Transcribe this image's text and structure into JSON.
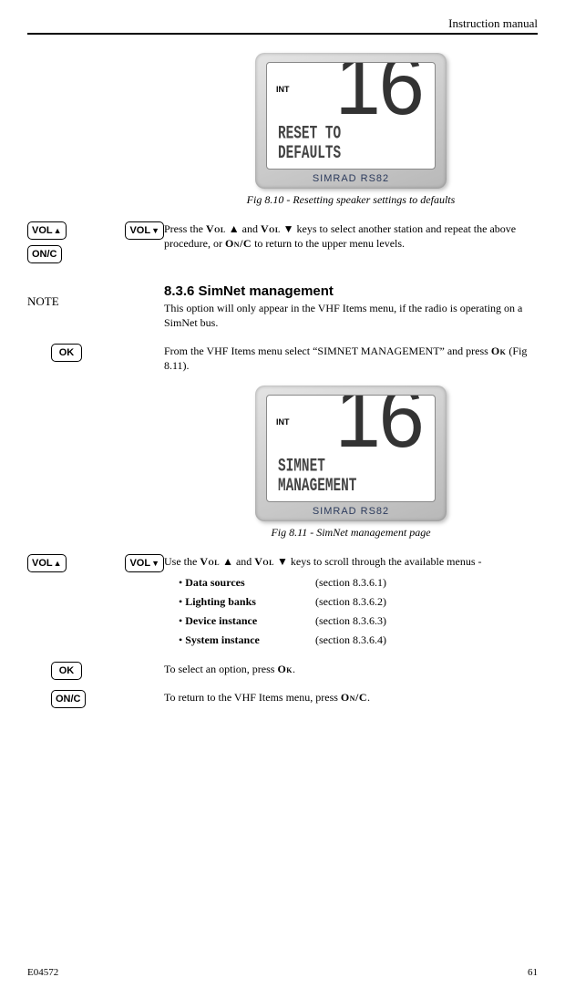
{
  "header": {
    "title": "Instruction manual"
  },
  "keys": {
    "vol_up": "VOL",
    "vol_down": "VOL",
    "on_c": "ON/C",
    "ok": "OK"
  },
  "device1": {
    "int": "INT",
    "channel": "16",
    "line1": "RESET TO",
    "line2": "DEFAULTS",
    "brand": "SIMRAD RS82"
  },
  "fig1_caption": "Fig 8.10 - Resetting speaker settings to defaults",
  "para1_a": "Press the ",
  "para1_vol1": "Vol",
  "para1_b": " ▲ and ",
  "para1_vol2": "Vol",
  "para1_c": " ▼ keys to select another station and repeat the above procedure, or ",
  "para1_onc": "On/C",
  "para1_d": " to return to the upper menu levels.",
  "section_title": "8.3.6  SimNet management",
  "note_label": "NOTE",
  "note_text": "This option will only appear in the VHF Items menu, if the radio is operating on a SimNet bus.",
  "para2_a": "From the VHF Items menu select “SIMNET MANAGEMENT” and press ",
  "para2_ok": "Ok",
  "para2_b": " (Fig 8.11).",
  "device2": {
    "int": "INT",
    "channel": "16",
    "line1": "SIMNET",
    "line2": "MANAGEMENT",
    "brand": "SIMRAD RS82"
  },
  "fig2_caption": "Fig 8.11 - SimNet management page",
  "para3_a": "Use the ",
  "para3_vol1": "Vol",
  "para3_b": " ▲ and ",
  "para3_vol2": "Vol",
  "para3_c": " ▼ keys to scroll through the available menus -",
  "menu": [
    {
      "name": "Data sources",
      "ref": "(section 8.3.6.1)"
    },
    {
      "name": "Lighting banks",
      "ref": "(section 8.3.6.2)"
    },
    {
      "name": "Device instance",
      "ref": "(section 8.3.6.3)"
    },
    {
      "name": "System instance",
      "ref": "(section 8.3.6.4)"
    }
  ],
  "para4_a": "To select an option, press ",
  "para4_ok": "Ok",
  "para4_b": ".",
  "para5_a": "To return to the VHF Items menu, press ",
  "para5_onc": "On/C",
  "para5_b": ".",
  "footer": {
    "code": "E04572",
    "page": "61"
  }
}
